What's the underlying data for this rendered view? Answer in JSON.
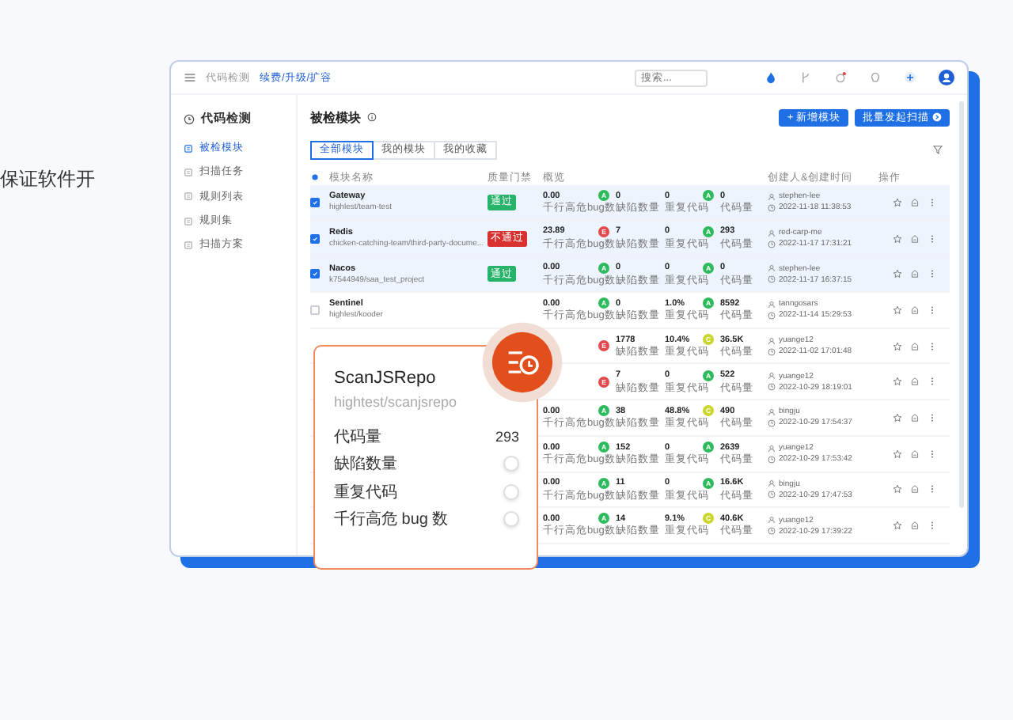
{
  "intro_text": "保证软件开",
  "window": {
    "breadcrumb": [
      {
        "label": "代码检测",
        "current": false
      },
      {
        "label": "续费/升级/扩容",
        "current": true
      }
    ],
    "search": {
      "placeholder": "搜索..."
    },
    "notifications": {
      "unread": true
    },
    "sidebar": {
      "title": "代码检测",
      "items": [
        {
          "label": "被检模块",
          "selected": true
        },
        {
          "label": "扫描任务",
          "selected": false
        },
        {
          "label": "规则列表",
          "selected": false
        },
        {
          "label": "规则集",
          "selected": false
        },
        {
          "label": "扫描方案",
          "selected": false
        }
      ]
    },
    "page_title": "被检模块",
    "new_button": {
      "label": "+ 新增模块"
    },
    "batch_button": {
      "label": "批量发起扫描"
    },
    "tabs": [
      {
        "label": "全部模块",
        "selected": true
      },
      {
        "label": "我的模块",
        "selected": false
      },
      {
        "label": "我的收藏",
        "selected": false
      }
    ],
    "columns": [
      "模块名称",
      "质量门禁",
      "概览",
      "创建人&创建时间",
      "操作"
    ],
    "rows": [
      {
        "checked": true,
        "name": "Gateway",
        "path": "highlest/team-test",
        "gate": {
          "label": "通过",
          "kind": "pass"
        },
        "m1": {
          "value": "0.00",
          "label": "千行高危bug数",
          "grade": {
            "letter": "A",
            "color": "#2dbb5d"
          }
        },
        "m2": {
          "value": "0",
          "label": "缺陷数量"
        },
        "m3": {
          "value": "0",
          "label": "重复代码",
          "grade": {
            "letter": "A",
            "color": "#2dbb5d"
          }
        },
        "m4": {
          "value": "0",
          "label": "代码量"
        },
        "creator": "stephen-lee",
        "time": "2022-11-18 11:38:53"
      },
      {
        "checked": true,
        "name": "Redis",
        "path": "chicken-catching-team/third-party-docume...",
        "gate": {
          "label": "不通过",
          "kind": "fail"
        },
        "m1": {
          "value": "23.89",
          "label": "千行高危bug数",
          "grade": {
            "letter": "E",
            "color": "#e5484d"
          }
        },
        "m2": {
          "value": "7",
          "label": "缺陷数量"
        },
        "m3": {
          "value": "0",
          "label": "重复代码",
          "grade": {
            "letter": "A",
            "color": "#2dbb5d"
          }
        },
        "m4": {
          "value": "293",
          "label": "代码量"
        },
        "creator": "red-carp-me",
        "time": "2022-11-17 17:31:21"
      },
      {
        "checked": true,
        "name": "Nacos",
        "path": "k7544949/saa_test_project",
        "gate": {
          "label": "通过",
          "kind": "pass"
        },
        "m1": {
          "value": "0.00",
          "label": "千行高危bug数",
          "grade": {
            "letter": "A",
            "color": "#2dbb5d"
          }
        },
        "m2": {
          "value": "0",
          "label": "缺陷数量"
        },
        "m3": {
          "value": "0",
          "label": "重复代码",
          "grade": {
            "letter": "A",
            "color": "#2dbb5d"
          }
        },
        "m4": {
          "value": "0",
          "label": "代码量"
        },
        "creator": "stephen-lee",
        "time": "2022-11-17 16:37:15"
      },
      {
        "checked": false,
        "name": "Sentinel",
        "path": "highlest/kooder",
        "m1": {
          "value": "0.00",
          "label": "千行高危bug数",
          "grade": {
            "letter": "A",
            "color": "#2dbb5d"
          }
        },
        "m2": {
          "value": "0",
          "label": "缺陷数量"
        },
        "m3": {
          "value": "1.0%",
          "label": "重复代码",
          "grade": {
            "letter": "A",
            "color": "#2dbb5d"
          }
        },
        "m4": {
          "value": "8592",
          "label": "代码量"
        },
        "creator": "tanngosars",
        "time": "2022-11-14 15:29:53"
      },
      {
        "m1": {
          "grade": {
            "letter": "E",
            "color": "#e5484d"
          }
        },
        "m2": {
          "value": "1778",
          "label": "缺陷数量"
        },
        "m3": {
          "value": "10.4%",
          "label": "重复代码",
          "grade": {
            "letter": "C",
            "color": "#c9d62c"
          }
        },
        "m4": {
          "value": "36.5K",
          "label": "代码量"
        },
        "creator": "yuange12",
        "time": "2022-11-02 17:01:48"
      },
      {
        "m1": {
          "grade": {
            "letter": "E",
            "color": "#e5484d"
          }
        },
        "m2": {
          "value": "7",
          "label": "缺陷数量"
        },
        "m3": {
          "value": "0",
          "label": "重复代码",
          "grade": {
            "letter": "A",
            "color": "#2dbb5d"
          }
        },
        "m4": {
          "value": "522",
          "label": "代码量"
        },
        "creator": "yuange12",
        "time": "2022-10-29 18:19:01"
      },
      {
        "m1": {
          "value": "0.00",
          "label": "千行高危bug数",
          "grade": {
            "letter": "A",
            "color": "#2dbb5d"
          }
        },
        "m2": {
          "value": "38",
          "label": "缺陷数量"
        },
        "m3": {
          "value": "48.8%",
          "label": "重复代码",
          "grade": {
            "letter": "C",
            "color": "#c9d62c"
          }
        },
        "m4": {
          "value": "490",
          "label": "代码量"
        },
        "creator": "bingju",
        "time": "2022-10-29 17:54:37"
      },
      {
        "m1": {
          "value": "0.00",
          "label": "千行高危bug数",
          "grade": {
            "letter": "A",
            "color": "#2dbb5d"
          }
        },
        "m2": {
          "value": "152",
          "label": "缺陷数量"
        },
        "m3": {
          "value": "0",
          "label": "重复代码",
          "grade": {
            "letter": "A",
            "color": "#2dbb5d"
          }
        },
        "m4": {
          "value": "2639",
          "label": "代码量"
        },
        "creator": "yuange12",
        "time": "2022-10-29 17:53:42"
      },
      {
        "m1": {
          "value": "0.00",
          "label": "千行高危bug数",
          "grade": {
            "letter": "A",
            "color": "#2dbb5d"
          }
        },
        "m2": {
          "value": "11",
          "label": "缺陷数量"
        },
        "m3": {
          "value": "0",
          "label": "重复代码",
          "grade": {
            "letter": "A",
            "color": "#2dbb5d"
          }
        },
        "m4": {
          "value": "16.6K",
          "label": "代码量"
        },
        "creator": "bingju",
        "time": "2022-10-29 17:47:53"
      },
      {
        "m1": {
          "value": "0.00",
          "label": "千行高危bug数",
          "grade": {
            "letter": "A",
            "color": "#2dbb5d"
          }
        },
        "m2": {
          "value": "14",
          "label": "缺陷数量"
        },
        "m3": {
          "value": "9.1%",
          "label": "重复代码",
          "grade": {
            "letter": "C",
            "color": "#c9d62c"
          }
        },
        "m4": {
          "value": "40.6K",
          "label": "代码量"
        },
        "creator": "yuange12",
        "time": "2022-10-29 17:39:22"
      }
    ]
  },
  "card": {
    "title": "ScanJSRepo",
    "path": "hightest/scanjsrepo",
    "metrics": [
      {
        "kind": "value",
        "label": "代码量",
        "value": "293"
      },
      {
        "kind": "toggle",
        "label": "缺陷数量",
        "on": false
      },
      {
        "kind": "toggle",
        "label": "重复代码",
        "on": false
      },
      {
        "kind": "toggle",
        "label": "千行高危 bug 数",
        "on": false
      }
    ]
  }
}
